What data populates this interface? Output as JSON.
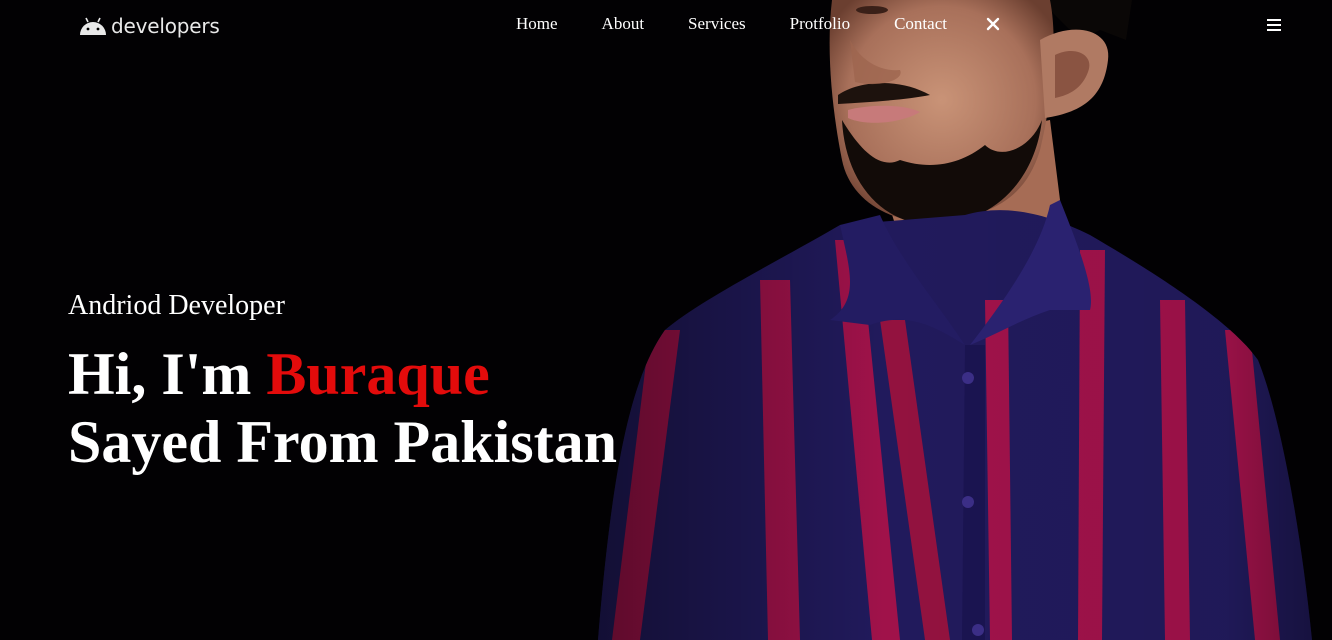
{
  "brand": {
    "name": "developers",
    "icon": "android-head-icon"
  },
  "nav": {
    "items": [
      {
        "label": "Home"
      },
      {
        "label": "About"
      },
      {
        "label": "Services"
      },
      {
        "label": "Protfolio"
      },
      {
        "label": "Contact"
      }
    ],
    "close_icon": "close-icon",
    "menu_icon": "hamburger-menu-icon"
  },
  "hero": {
    "subtitle": "Andriod Developer",
    "greeting": "Hi, I'm ",
    "name_highlight": "Buraque",
    "line2": "Sayed From Pakistan"
  },
  "colors": {
    "background": "#020103",
    "accent": "#e30b0b",
    "text": "#ffffff",
    "shirt_navy": "#211a5c",
    "shirt_stripe": "#a0124a"
  }
}
